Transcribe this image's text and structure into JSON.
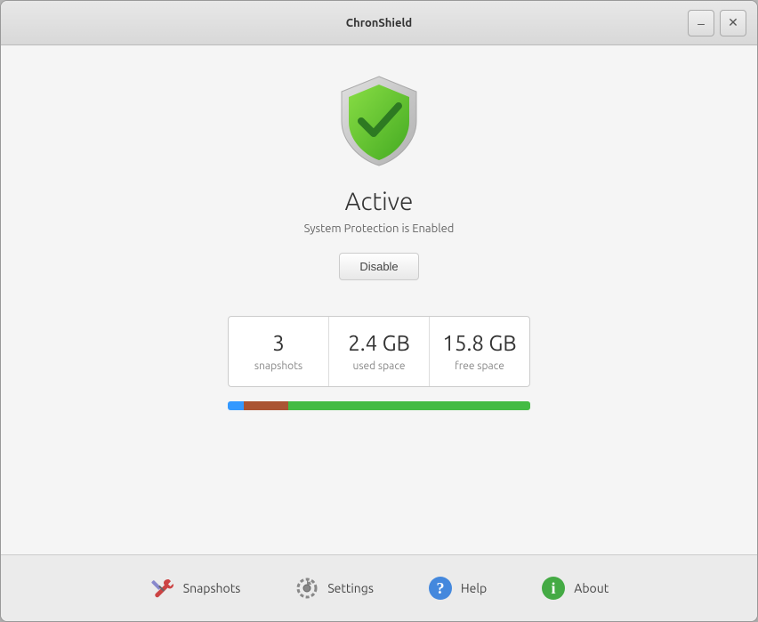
{
  "window": {
    "title": "ChronShield"
  },
  "titlebar": {
    "minimize_label": "–",
    "close_label": "✕"
  },
  "status": {
    "title": "Active",
    "subtitle": "System Protection is Enabled",
    "disable_button": "Disable"
  },
  "stats": [
    {
      "value": "3",
      "label": "snapshots"
    },
    {
      "value": "2.4 GB",
      "label": "used space"
    },
    {
      "value": "15.8 GB",
      "label": "free space"
    }
  ],
  "nav": [
    {
      "label": "Snapshots",
      "icon": "tools-icon"
    },
    {
      "label": "Settings",
      "icon": "gear-icon"
    },
    {
      "label": "Help",
      "icon": "help-icon"
    },
    {
      "label": "About",
      "icon": "info-icon"
    }
  ]
}
